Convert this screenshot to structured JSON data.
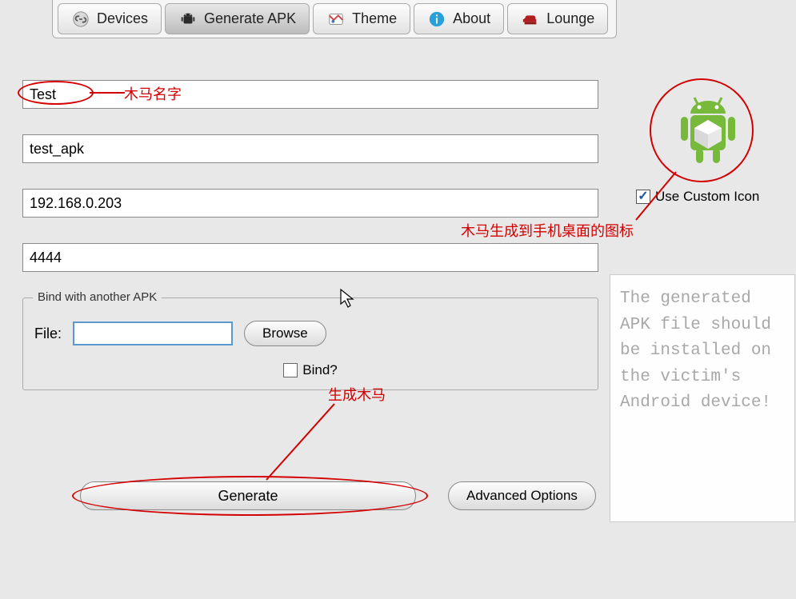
{
  "tabs": {
    "devices": "Devices",
    "generate_apk": "Generate APK",
    "theme": "Theme",
    "about": "About",
    "lounge": "Lounge"
  },
  "form": {
    "name_value": "Test",
    "apk_value": "test_apk",
    "ip_value": "192.168.0.203",
    "port_value": "4444"
  },
  "bind_section": {
    "legend": "Bind with another APK",
    "file_label": "File:",
    "file_value": "",
    "browse_label": "Browse",
    "bind_checkbox_label": "Bind?"
  },
  "buttons": {
    "generate": "Generate",
    "advanced": "Advanced Options"
  },
  "right": {
    "use_custom_icon_label": "Use Custom Icon",
    "info_text": "The generated APK file should be installed on the victim's Android device!"
  },
  "annotations": {
    "name": "木马名字",
    "icon": "木马生成到手机桌面的图标",
    "generate": "生成木马"
  }
}
